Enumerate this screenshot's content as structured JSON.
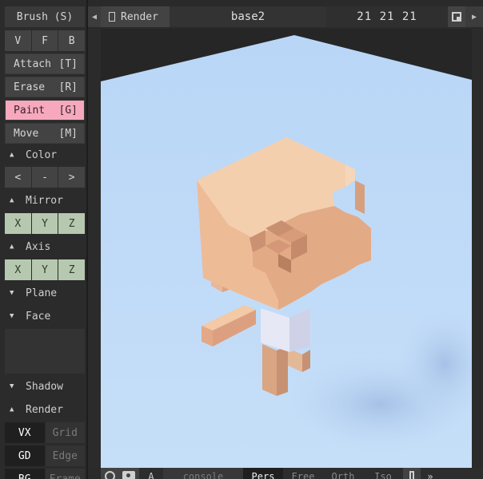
{
  "sidebar": {
    "title": "Brush (S)",
    "view_modes": [
      "V",
      "F",
      "B"
    ],
    "tools": [
      {
        "label": "Attach",
        "key": "[T]",
        "active": false
      },
      {
        "label": "Erase",
        "key": "[R]",
        "active": false
      },
      {
        "label": "Paint",
        "key": "[G]",
        "active": true
      },
      {
        "label": "Move",
        "key": "[M]",
        "active": false
      }
    ],
    "color_header": "Color",
    "color_buttons": [
      "<",
      "-",
      ">"
    ],
    "mirror_header": "Mirror",
    "mirror_axes": [
      "X",
      "Y",
      "Z"
    ],
    "axis_header": "Axis",
    "axis_axes": [
      "X",
      "Y",
      "Z"
    ],
    "plane_header": "Plane",
    "face_header": "Face",
    "shadow_header": "Shadow",
    "render_header": "Render",
    "render_rows": [
      [
        "VX",
        "Grid"
      ],
      [
        "GD",
        "Edge"
      ],
      [
        "BG",
        "Frame"
      ]
    ],
    "expand_icon": "triangle-up-icon",
    "collapse_icon": "triangle-down-icon"
  },
  "topbar": {
    "render_label": "Render",
    "model_name": "base2",
    "model_size": "21 21 21"
  },
  "bottombar": {
    "a_label": "A",
    "console_placeholder": "console",
    "modes": [
      "Pers",
      "Free",
      "Orth",
      "Iso"
    ],
    "active_mode": "Pers",
    "chevron": "»"
  },
  "colors": {
    "background_sky": "#bcd9f7",
    "paint_active": "#f6a9bd",
    "mirror_green": "#b6c9b0",
    "voxel_skin": "#f2c8a2"
  }
}
